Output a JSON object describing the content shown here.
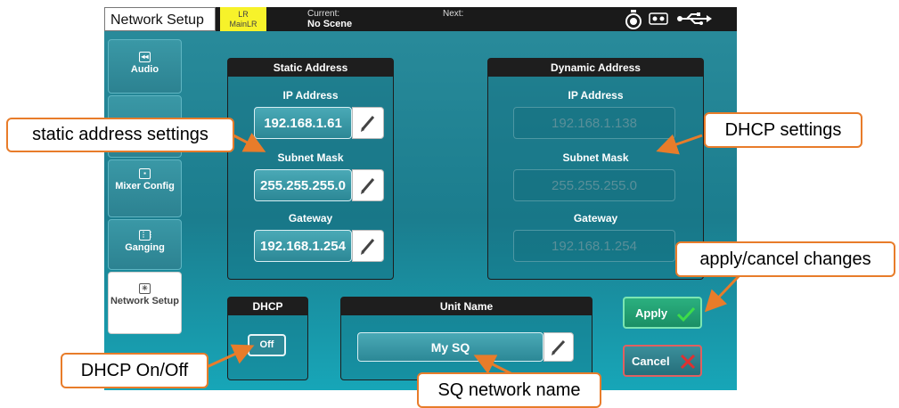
{
  "topbar": {
    "title": "Network Setup",
    "mix_line1": "LR",
    "mix_line2": "MainLR",
    "current_label": "Current:",
    "current_value": "No Scene",
    "next_label": "Next:",
    "icons": [
      "stopwatch-icon",
      "tape-icon",
      "usb-icon"
    ]
  },
  "sidebar": {
    "items": [
      {
        "label": "Audio",
        "icon": "audio-icon"
      },
      {
        "label": "Mixer Config",
        "icon": "mixer-config-icon"
      },
      {
        "label": "Ganging",
        "icon": "ganging-icon"
      },
      {
        "label": "Network Setup",
        "icon": "network-icon",
        "active": true
      }
    ]
  },
  "static_address": {
    "title": "Static Address",
    "ip_label": "IP Address",
    "ip_value": "192.168.1.61",
    "subnet_label": "Subnet Mask",
    "subnet_value": "255.255.255.0",
    "gateway_label": "Gateway",
    "gateway_value": "192.168.1.254"
  },
  "dynamic_address": {
    "title": "Dynamic Address",
    "ip_label": "IP Address",
    "ip_value": "192.168.1.138",
    "subnet_label": "Subnet Mask",
    "subnet_value": "255.255.255.0",
    "gateway_label": "Gateway",
    "gateway_value": "192.168.1.254"
  },
  "dhcp": {
    "title": "DHCP",
    "toggle_label": "Off"
  },
  "unit_name": {
    "title": "Unit Name",
    "value": "My SQ"
  },
  "actions": {
    "apply_label": "Apply",
    "cancel_label": "Cancel"
  },
  "annotations": {
    "static": "static address settings",
    "dhcp_settings": "DHCP settings",
    "apply_cancel": "apply/cancel changes",
    "dhcp_onoff": "DHCP On/Off",
    "network_name": "SQ network name"
  },
  "colors": {
    "accent_orange": "#e87c2a",
    "screen_teal": "#1b7d8e",
    "apply_green": "#1b8f65",
    "cancel_red": "#e03030",
    "mix_yellow": "#f7f22a"
  }
}
